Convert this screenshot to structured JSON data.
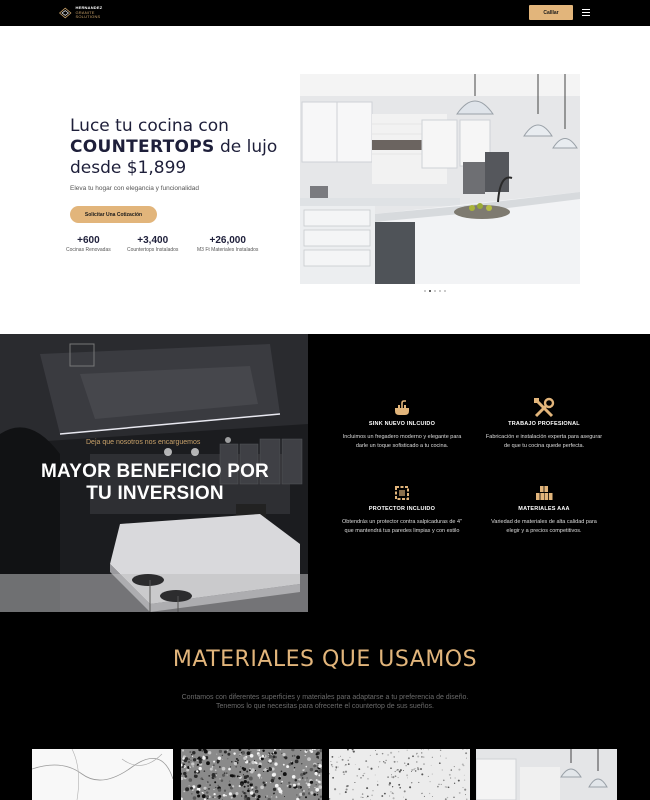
{
  "header": {
    "logo_name": "HERNANDEZ",
    "logo_tagline": "GRANITE SOLUTIONS",
    "call_label": "Calllar",
    "menu_icon": "menu-icon"
  },
  "hero": {
    "title_line1": "Luce tu cocina con",
    "title_bold": "COUNTERTOPS",
    "title_line2_rest": " de lujo",
    "title_line3": "desde $1,899",
    "subtitle": "Eleva tu hogar con elegancia y funcionalidad",
    "cta_label": "Solicitar Una Cotización",
    "stats": [
      {
        "num": "+600",
        "label": "Cocinas Renovadas"
      },
      {
        "num": "+3,400",
        "label": "Countertops Instalados"
      },
      {
        "num": "+26,000",
        "label": "M3 Ft Materiales Instalados"
      }
    ],
    "slider_dots": 5,
    "active_dot": 1
  },
  "benefit": {
    "kicker": "Deja que nosotros nos encarguemos",
    "title": "MAYOR BENEFICIO POR TU INVERSION",
    "features": [
      {
        "icon": "sink-icon",
        "title": "SINK NUEVO INLCUIDO",
        "desc": "Incluimos un fregadero moderno y elegante para darle un toque sofisticado a tu cocina."
      },
      {
        "icon": "tools-icon",
        "title": "TRABAJO PROFESIONAL",
        "desc": "Fabricación e instalación experta para asegurar de que tu cocina quede perfecta."
      },
      {
        "icon": "protector-icon",
        "title": "PROTECTOR INCLUIDO",
        "desc": "Obtendrás un protector contra salpicaduras de 4\" que mantendrá tus paredes limpias y con estilo"
      },
      {
        "icon": "boxes-icon",
        "title": "MATERIALES AAA",
        "desc": "Variedad de materiales de alta calidad para elegir y a precios competitivos."
      }
    ]
  },
  "materials": {
    "title": "MATERIALES QUE USAMOS",
    "subtitle_line1": "Contamos con diferentes superficies y materiales para adaptarse a tu preferencia de diseño.",
    "subtitle_line2": "Tenemos lo que necesitas para ofrecerte el countertop de sus sueños."
  },
  "colors": {
    "accent": "#e2b57b",
    "navy": "#1e1f3a",
    "black": "#000000"
  }
}
